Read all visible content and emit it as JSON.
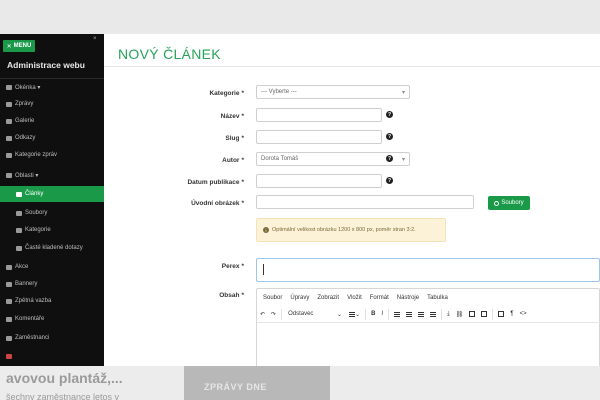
{
  "background": {
    "headline": "avovou plantáž,...",
    "subline": "šechny zaměstnance letos v",
    "image_label": "ZPRÁVY DNE"
  },
  "sidebar": {
    "menu_label": "MENU",
    "close_glyph": "×",
    "title": "Administrace webu",
    "items": [
      {
        "label": "Okénka ▾",
        "icon": "window-icon",
        "level": 1
      },
      {
        "label": "Zprávy",
        "icon": "bars-icon",
        "level": 1
      },
      {
        "label": "Galerie",
        "icon": "picture-icon",
        "level": 1
      },
      {
        "label": "Odkazy",
        "icon": "link-icon",
        "level": 1
      },
      {
        "label": "Kategorie zpráv",
        "icon": "list-icon",
        "level": 1
      },
      {
        "label": "Oblasti ▾",
        "icon": "folder-icon",
        "level": 1
      },
      {
        "label": "Články",
        "icon": "document-icon",
        "level": 2,
        "active": true
      },
      {
        "label": "Soubory",
        "icon": "file-icon",
        "level": 2
      },
      {
        "label": "Kategorie",
        "icon": "tag-icon",
        "level": 2
      },
      {
        "label": "Časté kladené dotazy",
        "icon": "question-icon",
        "level": 2
      },
      {
        "label": "Akce",
        "icon": "calendar-icon",
        "level": 1
      },
      {
        "label": "Bannery",
        "icon": "image-icon",
        "level": 1
      },
      {
        "label": "Zpětná vazba",
        "icon": "comment-icon",
        "level": 1
      },
      {
        "label": "Komentáře",
        "icon": "comments-icon",
        "level": 1
      },
      {
        "label": "Zaměstnanci",
        "icon": "users-icon",
        "level": 1
      },
      {
        "label": "",
        "icon": "flag-icon",
        "level": 1
      }
    ]
  },
  "page": {
    "title": "NOVÝ ČLÁNEK"
  },
  "form": {
    "category_label": "Kategorie",
    "category_value": "--- Vyberte ---",
    "name_label": "Název",
    "slug_label": "Slug",
    "author_label": "Autor",
    "author_value": "Dorota Tomáš",
    "pubdate_label": "Datum publikace",
    "intro_image_label": "Úvodní obrázek",
    "files_button": "Soubory",
    "info_text": "Optimální velikost obrázku 1200 x 800 px, poměr stran 3:2.",
    "perex_label": "Perex",
    "content_label": "Obsah",
    "required_mark": "*"
  },
  "editor": {
    "menu": [
      "Soubor",
      "Úpravy",
      "Zobrazit",
      "Vložit",
      "Formát",
      "Nástroje",
      "Tabulka"
    ],
    "format_value": "Odstavec",
    "bold": "B",
    "italic": "I",
    "pilcrow": "¶",
    "code": "<>"
  },
  "colors": {
    "accent": "#1a9a49",
    "title_green": "#27a35a",
    "sidebar_bg": "#0f0f0f",
    "info_bg": "#fcf2d7"
  }
}
